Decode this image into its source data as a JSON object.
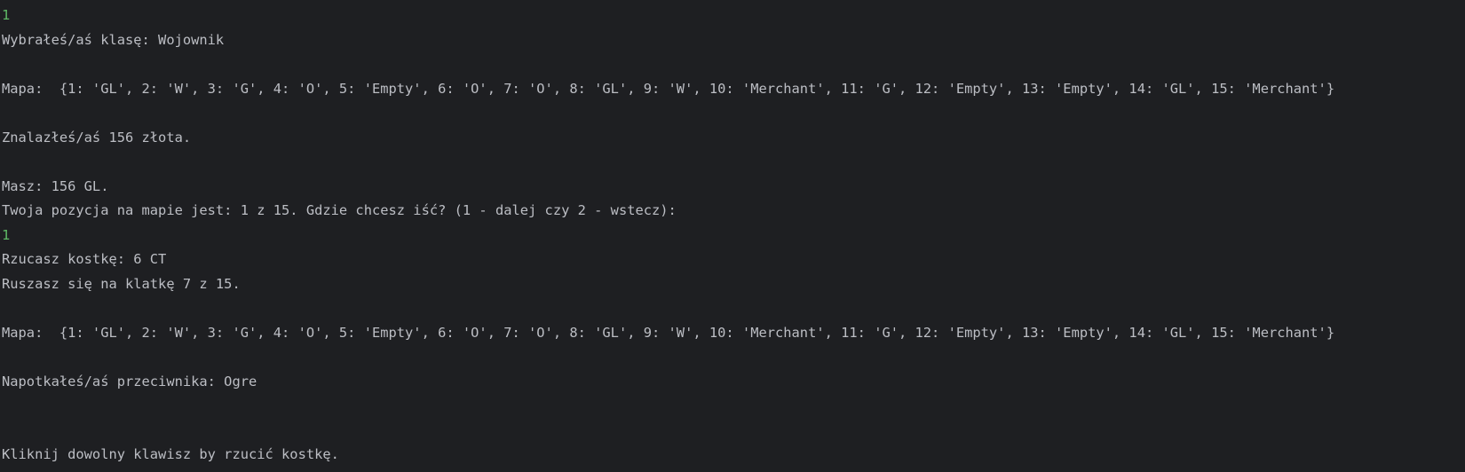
{
  "console": {
    "lines": [
      {
        "text": "1",
        "kind": "input"
      },
      {
        "text": "Wybrałeś/aś klasę: Wojownik",
        "kind": "output"
      },
      {
        "text": "",
        "kind": "blank"
      },
      {
        "text": "Mapa:  {1: 'GL', 2: 'W', 3: 'G', 4: 'O', 5: 'Empty', 6: 'O', 7: 'O', 8: 'GL', 9: 'W', 10: 'Merchant', 11: 'G', 12: 'Empty', 13: 'Empty', 14: 'GL', 15: 'Merchant'}",
        "kind": "output"
      },
      {
        "text": "",
        "kind": "blank"
      },
      {
        "text": "Znalazłeś/aś 156 złota.",
        "kind": "output"
      },
      {
        "text": "",
        "kind": "blank"
      },
      {
        "text": "Masz: 156 GL.",
        "kind": "output"
      },
      {
        "text": "Twoja pozycja na mapie jest: 1 z 15. Gdzie chcesz iść? (1 - dalej czy 2 - wstecz):",
        "kind": "output"
      },
      {
        "text": "1",
        "kind": "input"
      },
      {
        "text": "Rzucasz kostkę: 6 CT",
        "kind": "output"
      },
      {
        "text": "Ruszasz się na klatkę 7 z 15.",
        "kind": "output"
      },
      {
        "text": "",
        "kind": "blank"
      },
      {
        "text": "Mapa:  {1: 'GL', 2: 'W', 3: 'G', 4: 'O', 5: 'Empty', 6: 'O', 7: 'O', 8: 'GL', 9: 'W', 10: 'Merchant', 11: 'G', 12: 'Empty', 13: 'Empty', 14: 'GL', 15: 'Merchant'}",
        "kind": "output"
      },
      {
        "text": "",
        "kind": "blank"
      },
      {
        "text": "Napotkałeś/aś przeciwnika: Ogre",
        "kind": "output"
      },
      {
        "text": "",
        "kind": "blank"
      },
      {
        "text": "",
        "kind": "blank"
      },
      {
        "text": "Kliknij dowolny klawisz by rzucić kostkę.",
        "kind": "output"
      }
    ]
  },
  "colors": {
    "background": "#1e1f22",
    "output_text": "#bcbec4",
    "input_text": "#5fb865"
  }
}
